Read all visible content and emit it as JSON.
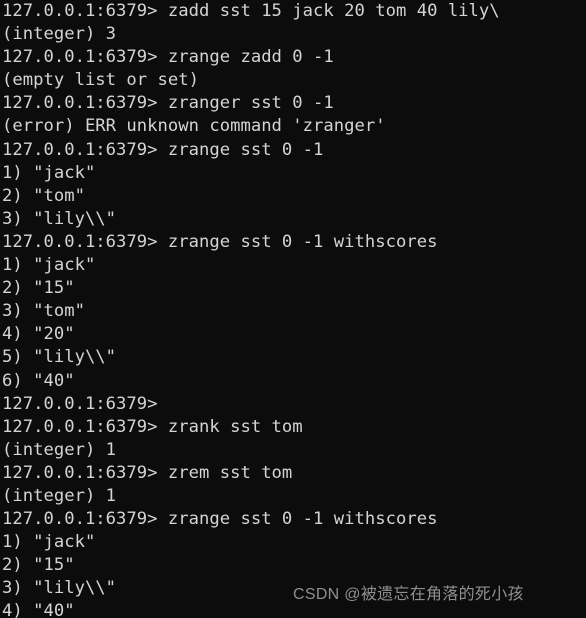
{
  "terminal": {
    "background_color": "#0c0c0c",
    "foreground_color": "#d4d4d4",
    "prompt": "127.0.0.1:6379>",
    "lines": [
      "127.0.0.1:6379> zadd sst 15 jack 20 tom 40 lily\\",
      "(integer) 3",
      "127.0.0.1:6379> zrange zadd 0 -1",
      "(empty list or set)",
      "127.0.0.1:6379> zranger sst 0 -1",
      "(error) ERR unknown command 'zranger'",
      "127.0.0.1:6379> zrange sst 0 -1",
      "1) \"jack\"",
      "2) \"tom\"",
      "3) \"lily\\\\\"",
      "127.0.0.1:6379> zrange sst 0 -1 withscores",
      "1) \"jack\"",
      "2) \"15\"",
      "3) \"tom\"",
      "4) \"20\"",
      "5) \"lily\\\\\"",
      "6) \"40\"",
      "127.0.0.1:6379>",
      "127.0.0.1:6379> zrank sst tom",
      "(integer) 1",
      "127.0.0.1:6379> zrem sst tom",
      "(integer) 1",
      "127.0.0.1:6379> zrange sst 0 -1 withscores",
      "1) \"jack\"",
      "2) \"15\"",
      "3) \"lily\\\\\"",
      "4) \"40\""
    ]
  },
  "watermark": {
    "text": "CSDN @被遗忘在角落的死小孩",
    "color": "#8f8f8f"
  }
}
